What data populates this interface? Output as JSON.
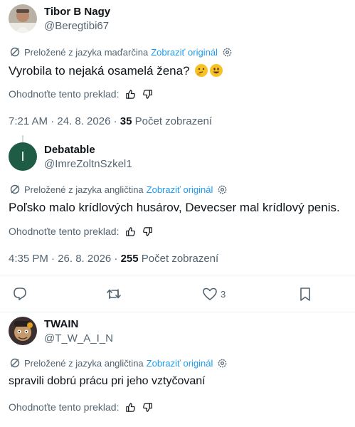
{
  "tweets": [
    {
      "author": "Tibor B Nagy",
      "handle": "@Beregtibi67",
      "translated_label": "Preložené z jazyka maďarčina",
      "show_original": "Zobraziť originál",
      "text": "Vyrobila to nejaká osamelá žena? ",
      "emojis": [
        "thinking-face",
        "grinning-face"
      ],
      "rate_label": "Ohodnoťte tento preklad:",
      "time": "7:21 AM · 24. 8. 2026 · ",
      "views_count": "35",
      "views_label": "Počet zobrazení"
    },
    {
      "author": "Debatable",
      "handle": "@ImreZoltnSzkel1",
      "avatar_letter": "I",
      "translated_label": "Preložené z jazyka angličtina",
      "show_original": "Zobraziť originál",
      "text": "Poľsko malo krídlových husárov, Devecser mal krídlový penis.",
      "rate_label": "Ohodnoťte tento preklad:",
      "time": "4:35 PM · 26. 8. 2026 · ",
      "views_count": "255",
      "views_label": "Počet zobrazení",
      "likes": "3"
    },
    {
      "author": "TWAIN",
      "handle": "@T_W_A_I_N",
      "translated_label": "Preložené z jazyka angličtina",
      "show_original": "Zobraziť originál",
      "text": "spravili dobrú prácu pri jeho vztyčovaní",
      "rate_label": "Ohodnoťte tento preklad:"
    }
  ],
  "icons": {
    "translate": "translate-icon",
    "settings": "gear-icon",
    "thumb_up": "thumbs-up-icon",
    "thumb_down": "thumbs-down-icon",
    "reply": "reply-icon",
    "retweet": "retweet-icon",
    "like": "heart-icon",
    "bookmark": "bookmark-icon"
  },
  "colors": {
    "accent": "#1d9bf0",
    "secondary_text": "#536471",
    "avatar_green": "#1f5c46"
  }
}
